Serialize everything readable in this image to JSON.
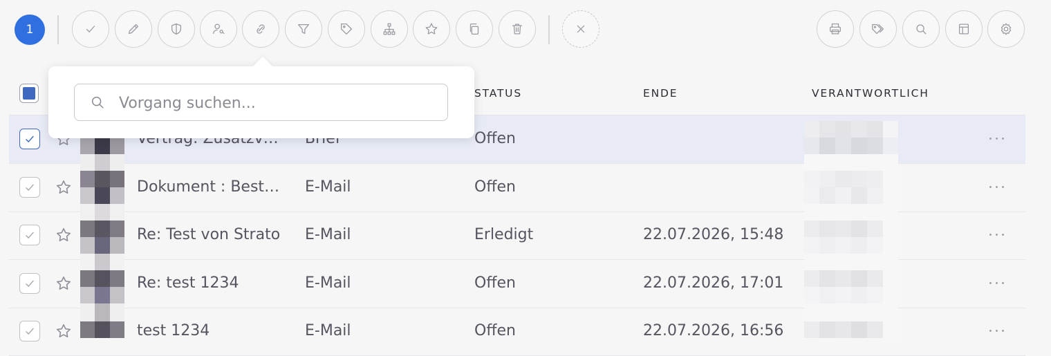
{
  "toolbar": {
    "selected_count": "1",
    "actions": [
      {
        "name": "check-icon"
      },
      {
        "name": "pencil-icon"
      },
      {
        "name": "shield-icon"
      },
      {
        "name": "user-key-icon"
      },
      {
        "name": "link-icon"
      },
      {
        "name": "filter-icon"
      },
      {
        "name": "tag-icon"
      },
      {
        "name": "hierarchy-icon"
      },
      {
        "name": "star-icon"
      },
      {
        "name": "copy-icon"
      },
      {
        "name": "trash-icon"
      },
      {
        "name": "close-icon"
      }
    ],
    "right_actions": [
      {
        "name": "print-icon"
      },
      {
        "name": "tags-icon"
      },
      {
        "name": "search-icon"
      },
      {
        "name": "columns-icon"
      },
      {
        "name": "gear-icon"
      }
    ]
  },
  "search_popover": {
    "placeholder": "Vorgang suchen..."
  },
  "table": {
    "columns": {
      "status": "STATUS",
      "end": "ENDE",
      "responsible": "VERANTWORTLICH"
    },
    "rows": [
      {
        "title": "Vertrag: Zusatzvertrag",
        "type": "Brief",
        "status": "Offen",
        "end": "",
        "selected": true
      },
      {
        "title": "Dokument : Bestellschein",
        "type": "E-Mail",
        "status": "Offen",
        "end": "",
        "selected": false
      },
      {
        "title": "Re: Test von Strato",
        "type": "E-Mail",
        "status": "Erledigt",
        "end": "22.07.2026, 15:48",
        "selected": false
      },
      {
        "title": "Re: test 1234",
        "type": "E-Mail",
        "status": "Offen",
        "end": "22.07.2026, 17:01",
        "selected": false
      },
      {
        "title": "test 1234",
        "type": "E-Mail",
        "status": "Offen",
        "end": "22.07.2026, 16:56",
        "selected": false
      }
    ]
  },
  "colors": {
    "accent": "#2f6fe0",
    "selected_row": "#e8ebf6",
    "background": "#f6f6f7"
  }
}
